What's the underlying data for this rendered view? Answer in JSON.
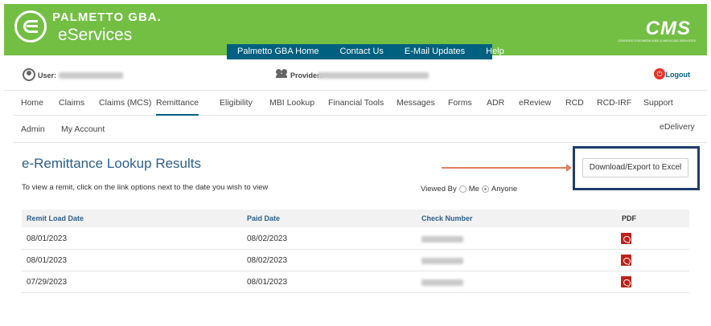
{
  "header": {
    "brand_top": "PALMETTO GBA.",
    "brand_bottom": "eServices",
    "cms": "CMS",
    "cms_sub": "CENTERS FOR MEDICARE & MEDICAID SERVICES",
    "top_links": [
      "Palmetto GBA Home",
      "Contact Us",
      "E-Mail Updates",
      "Help"
    ],
    "bg_color": "#72bf44",
    "nav_color": "#006080"
  },
  "userbar": {
    "user_label": "User:",
    "provider_label": "Provider:",
    "logout": "Logout"
  },
  "main_nav": [
    "Home",
    "Claims",
    "Claims (MCS)",
    "Remittance",
    "Eligibility",
    "MBI Lookup",
    "Financial Tools",
    "Messages",
    "Forms",
    "ADR",
    "eReview",
    "RCD",
    "RCD-IRF",
    "Support"
  ],
  "active_tab": "Remittance",
  "sub_nav": [
    "Admin",
    "My Account",
    "eDelivery"
  ],
  "content": {
    "title": "e-Remittance Lookup Results",
    "instructions": "To view a remit, click on the link options next to the date you wish to view",
    "download_button": "Download/Export to Excel",
    "viewed_by_label": "Viewed By",
    "viewed_options": [
      "Me",
      "Anyone"
    ],
    "viewed_selected": "Anyone"
  },
  "table": {
    "headers": [
      "Remit Load Date",
      "Paid Date",
      "Check Number",
      "PDF"
    ],
    "rows": [
      {
        "remit_load_date": "08/01/2023",
        "paid_date": "08/02/2023"
      },
      {
        "remit_load_date": "08/01/2023",
        "paid_date": "08/02/2023"
      },
      {
        "remit_load_date": "07/29/2023",
        "paid_date": "08/01/2023"
      }
    ]
  },
  "icons": [
    "user-icon",
    "provider-icon",
    "power-icon",
    "pdf-icon"
  ]
}
